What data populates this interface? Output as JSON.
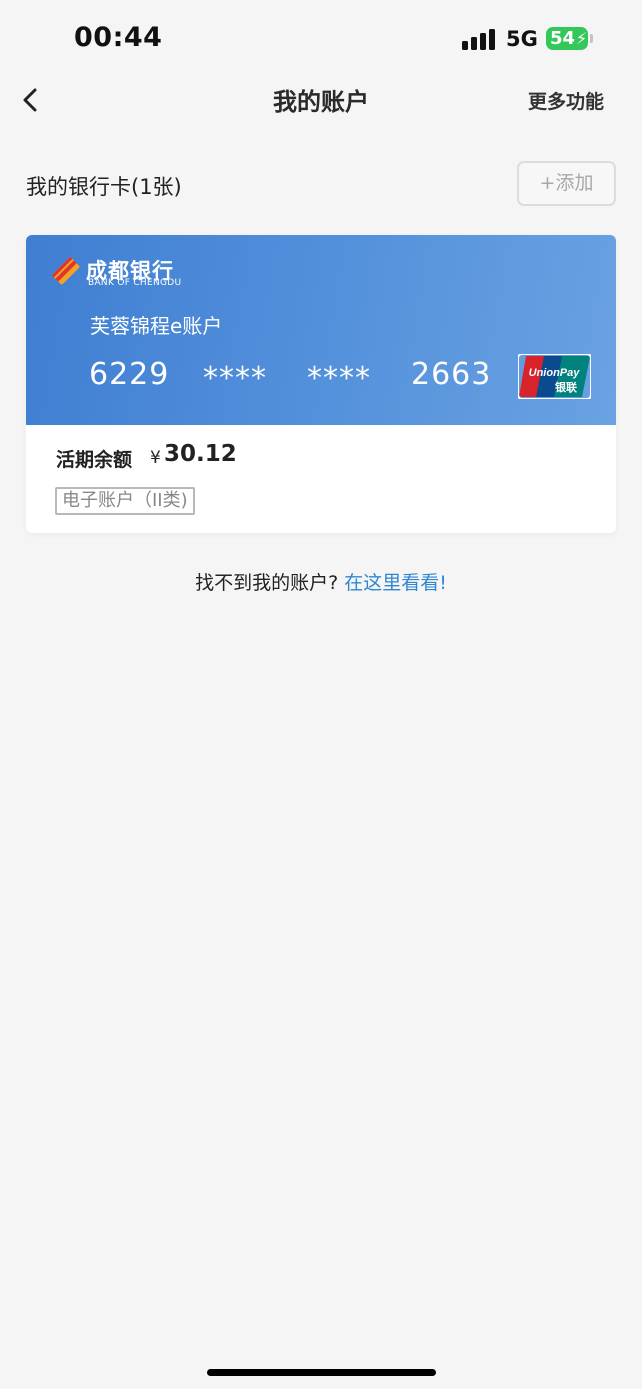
{
  "status_bar": {
    "time": "00:44",
    "network": "5G",
    "battery": "54"
  },
  "nav": {
    "title": "我的账户",
    "more_label": "更多功能"
  },
  "section": {
    "title": "我的银行卡(1张)",
    "add_label": "+添加"
  },
  "card": {
    "bank_name": "成都银行",
    "bank_name_en": "BANK OF CHENGDU",
    "account_type": "芙蓉锦程e账户",
    "number_groups": [
      "6229",
      "****",
      "****",
      "2663"
    ],
    "balance_label": "活期余额",
    "currency_symbol": "¥",
    "balance": "30.12",
    "account_class": "电子账户（II类)",
    "unionpay": {
      "en": "UnionPay",
      "cn": "银联"
    }
  },
  "help": {
    "text": "找不到我的账户?",
    "link": "在这里看看!"
  },
  "colors": {
    "card_blue": "#4a88d8",
    "link_blue": "#2f87d4",
    "battery_green": "#34c759"
  },
  "icons": [
    "back-chevron-icon",
    "bank-logo-icon",
    "unionpay-logo-icon"
  ]
}
